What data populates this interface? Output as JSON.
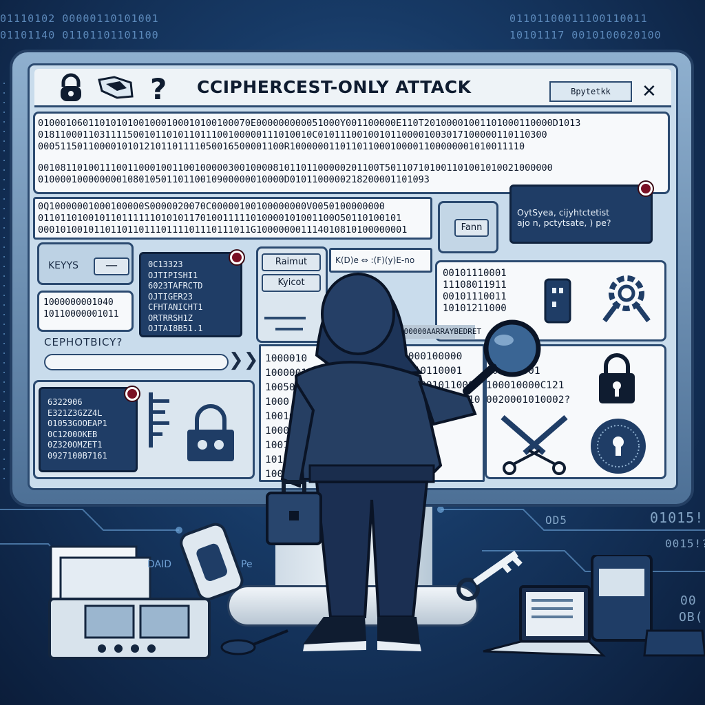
{
  "background": {
    "binary_top_left": "01110102 00000110101001",
    "binary_top_left_2": "01101140 01101101101100",
    "binary_top_right": "01101100011100110011",
    "binary_top_right_2": "10101117 0010100020100",
    "binary_right_edge": "01015!"
  },
  "window": {
    "title": "CCIPHERCEST-ONLY ATTACK",
    "title_field": "Bpytetkk",
    "close_glyph": "✕"
  },
  "ciphertext_block": {
    "lines": [
      "01000106011010101001000100010100100070E000000000051000Y001100000E110T20100001001101000110000D1013",
      "0181100011031111500101101011011100100000111010010C01011100100101100001003017100000110110300",
      "00051150110000101012101101111050016500001100R100000011011011000100001100000001010011110",
      "0010811010011100110001001100100000300100008101101100000201100T501107101001101001010021000000",
      "01000010000000010801050110110010900000010000D0101100000218200001101093"
    ]
  },
  "ciphertext_block_2": {
    "lines": [
      "0Q10000001000100000S0000020070C00000100100000000V0050100000000",
      "01101101001011011111101010117010011111010000101001100O50110100101",
      "00010100101101101101110111101110111011G100000001114010810100000001"
    ]
  },
  "decrypt_popup": {
    "lines": [
      "OytSyea, cijyhtctetist",
      "ajo n, pctytsate, ) pe?"
    ],
    "button": "Fann"
  },
  "keys_panel": {
    "label": "KEYYS",
    "dash": "—",
    "binary": [
      "1000000001040",
      "10110000001011"
    ],
    "caption": "CEPHOTBICY?",
    "arrows": "❯❯"
  },
  "key_list": {
    "lines": [
      "0C13323",
      "OJTIPISHI1",
      "6023TAFRCTD",
      "OJTIGER23",
      "CFHTANICHT1",
      "ORTRRSH1Z",
      "OJTAI8B51.1"
    ]
  },
  "lower_list": {
    "lines": [
      "6322906",
      "E321Z3GZZ4L",
      "01053GOOEAP1",
      "0C1200OKEB",
      "0Z320OMZET1",
      "0927100B7161"
    ]
  },
  "action_buttons": {
    "primary": "Raimut",
    "secondary": "Kyicot",
    "formula": "K(D)e ⇔ :(F)(y)E-no"
  },
  "scan_panel": {
    "lines": [
      "00101110001",
      "11108011911",
      "00101110011",
      "10101211000"
    ]
  },
  "highlight_bar": "000000000AARRAYBEDRET",
  "center_binary": {
    "lines": [
      "1000010",
      "10000010",
      "10050",
      "1000",
      "10010100",
      "1000000007",
      "10010000000",
      "101011110000005",
      "100001010000001010"
    ],
    "right": [
      "1000100000",
      "1010110001",
      "100001011000",
      "0000010001010"
    ]
  },
  "right_binary": {
    "lines": [
      "00011",
      "101211001",
      "100010000C121",
      "0020001010002?"
    ]
  },
  "desk": {
    "box_label_1": "DAID",
    "box_label_2": "Pe",
    "right_marks": [
      "OD5",
      "0015!?",
      "00",
      "OB("
    ]
  }
}
